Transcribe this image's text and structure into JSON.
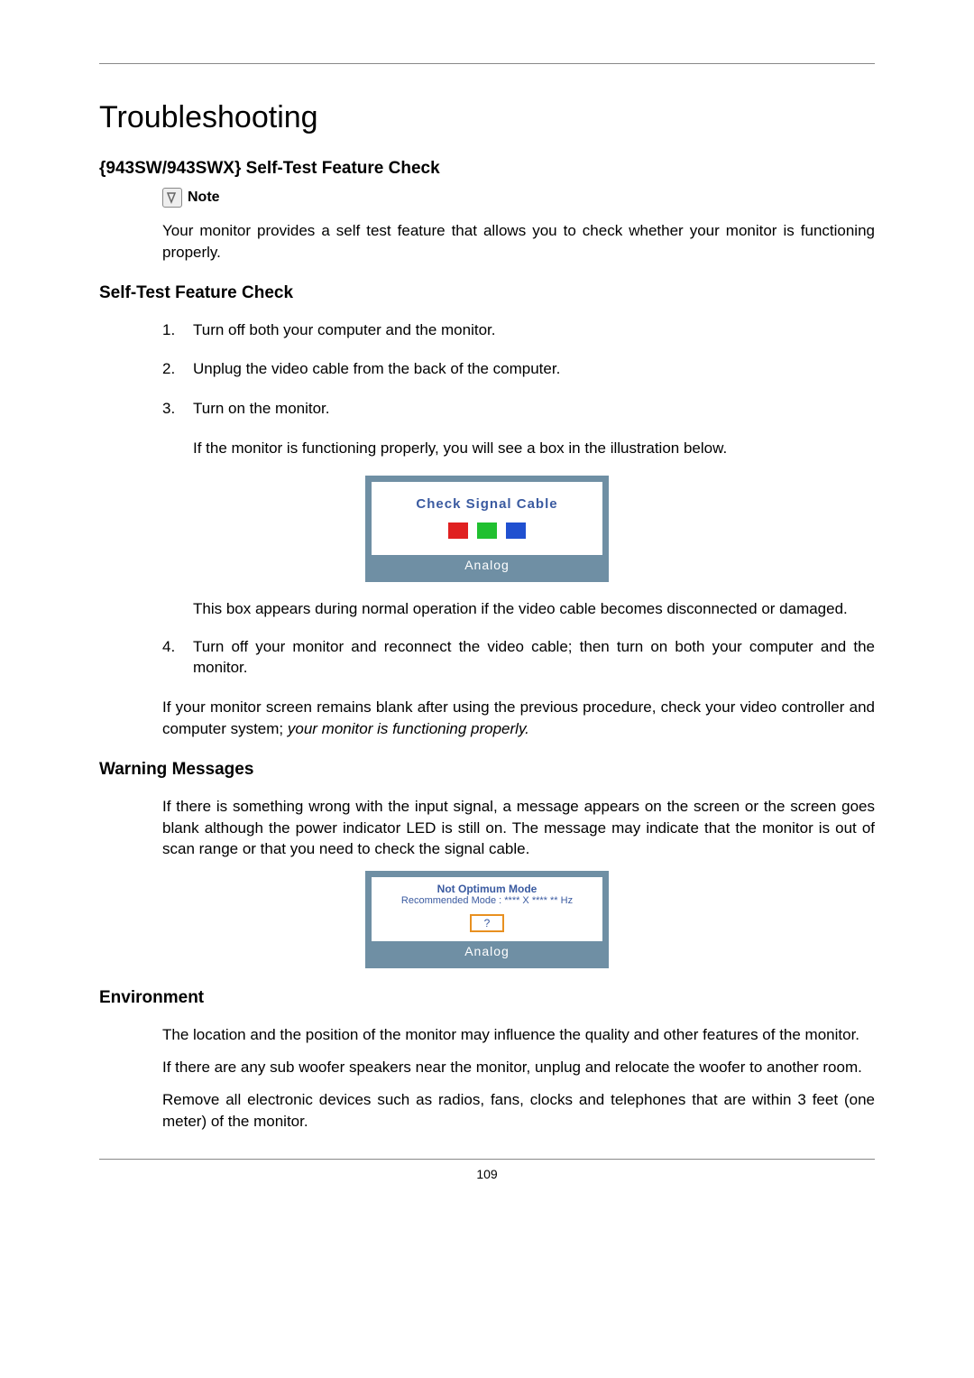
{
  "page_number": "109",
  "title": "Troubleshooting",
  "section1": {
    "heading": "{943SW/943SWX} Self-Test Feature Check",
    "note_label": "Note",
    "note_body": "Your monitor provides a self test feature that allows you to check whether your monitor is functioning properly."
  },
  "section2": {
    "heading": "Self-Test Feature Check",
    "steps": [
      {
        "num": "1.",
        "text": "Turn off both your computer and the monitor."
      },
      {
        "num": "2.",
        "text": "Unplug the video cable from the back of the computer."
      },
      {
        "num": "3.",
        "text": "Turn on the monitor."
      },
      {
        "num": "4.",
        "text": "Turn off your monitor and reconnect the video cable; then turn on both your computer and the monitor."
      }
    ],
    "step3_after": "If the monitor is functioning properly, you will see a box in the illustration below.",
    "osd1": {
      "title": "Check Signal Cable",
      "footer": "Analog"
    },
    "step3_after2": "This box appears during normal operation if the video cable becomes disconnected or damaged.",
    "closing_prefix": "If your monitor screen remains blank after using the previous procedure, check your video controller and computer system; ",
    "closing_italic": "your monitor is functioning properly."
  },
  "section3": {
    "heading": "Warning Messages",
    "body": "If there is something wrong with the input signal, a message appears on the screen or the screen goes blank although the power indicator LED is still on. The message may indicate that the monitor is out of scan range or that you need to check the signal cable.",
    "osd2": {
      "t1": "Not Optimum Mode",
      "t2": "Recommended Mode : **** X **** ** Hz",
      "btn": "?",
      "footer": "Analog"
    }
  },
  "section4": {
    "heading": "Environment",
    "p1": "The location and the position of the monitor may influence the quality and other features of the monitor.",
    "p2": "If there are any sub woofer speakers near the monitor, unplug and relocate the woofer to another room.",
    "p3": "Remove all electronic devices such as radios, fans, clocks and telephones that are within 3 feet (one meter) of the monitor."
  }
}
